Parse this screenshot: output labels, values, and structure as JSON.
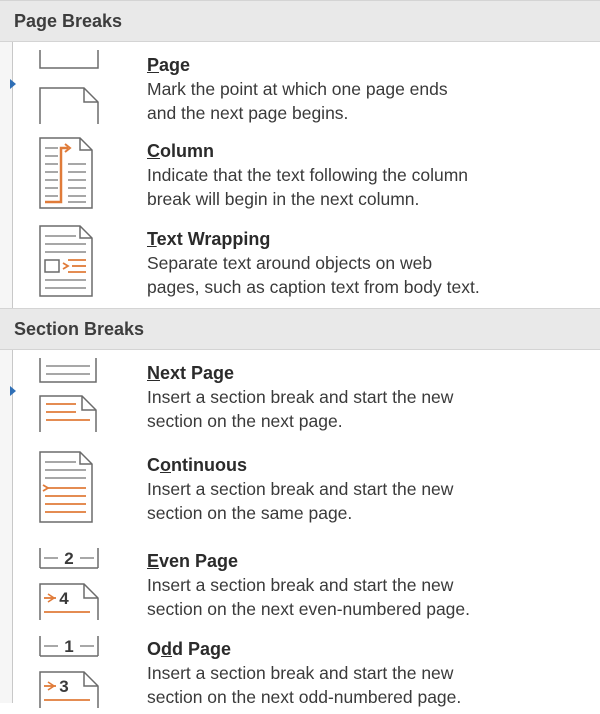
{
  "groups": [
    {
      "header": "Page Breaks",
      "items": [
        {
          "title": "Page",
          "accel": "P",
          "rest": "age",
          "desc": [
            "Mark the point at which one page ends",
            "and the next page begins."
          ],
          "icon": "page-break-icon"
        },
        {
          "title": "Column",
          "accel": "C",
          "rest": "olumn",
          "desc": [
            "Indicate that the text following the column",
            "break will begin in the next column."
          ],
          "icon": "column-break-icon"
        },
        {
          "title": "Text Wrapping",
          "accel": "T",
          "rest": "ext Wrapping",
          "desc": [
            "Separate text around objects on web",
            "pages, such as caption text from body text."
          ],
          "icon": "text-wrapping-icon"
        }
      ]
    },
    {
      "header": "Section Breaks",
      "items": [
        {
          "title": "Next Page",
          "accel": "N",
          "rest": "ext Page",
          "desc": [
            "Insert a section break and start the new",
            "section on the next page."
          ],
          "icon": "next-page-icon"
        },
        {
          "title": "Continuous",
          "pre": "C",
          "accel": "o",
          "rest": "ntinuous",
          "desc": [
            "Insert a section break and start the new",
            "section on the same page."
          ],
          "icon": "continuous-icon"
        },
        {
          "title": "Even Page",
          "accel": "E",
          "rest": "ven Page",
          "desc": [
            "Insert a section break and start the new",
            "section on the next even-numbered page."
          ],
          "icon": "even-page-icon",
          "nums": [
            "2",
            "4"
          ]
        },
        {
          "title": "Odd Page",
          "pre": "O",
          "accel": "d",
          "rest": "d Page",
          "desc": [
            "Insert a section break and start the new",
            "section on the next odd-numbered page."
          ],
          "icon": "odd-page-icon",
          "nums": [
            "1",
            "3"
          ]
        }
      ]
    }
  ],
  "colors": {
    "accent": "#e07b39",
    "line": "#6b6b6b",
    "arrow": "#2f6fb6",
    "header_bg": "#e9e9e9"
  }
}
